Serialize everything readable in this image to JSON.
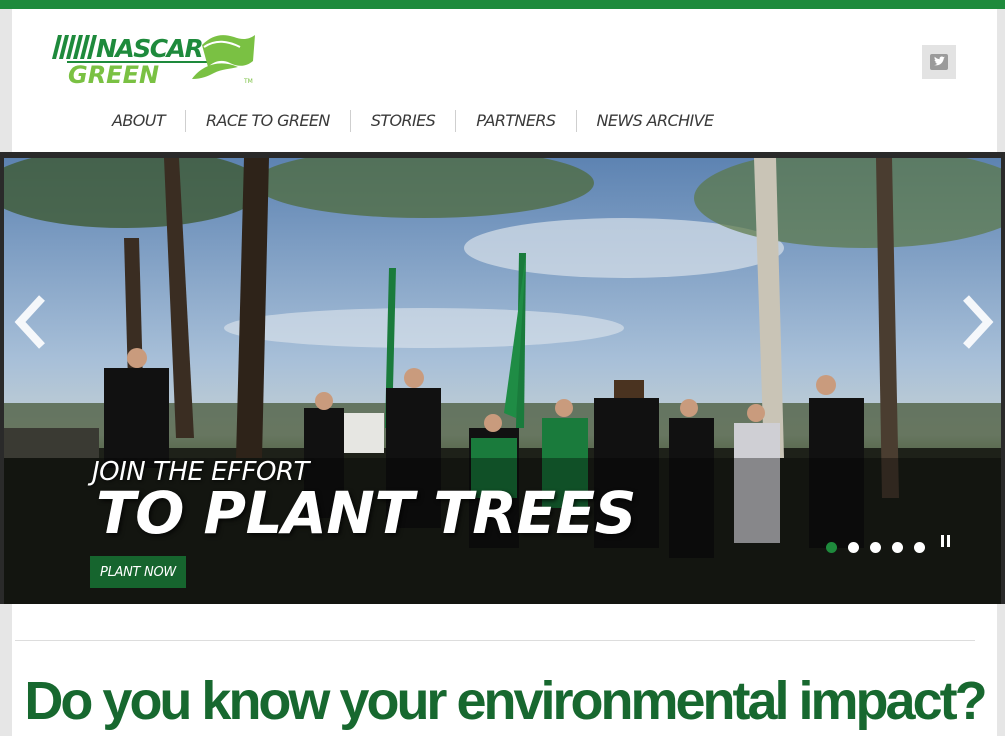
{
  "brand": {
    "logo_line1": "NASCAR",
    "logo_line2": "GREEN",
    "primary_color": "#1e8a3c",
    "dark_green": "#17682f",
    "light_green": "#7ac143"
  },
  "header": {
    "twitter_icon": "twitter-icon"
  },
  "nav": {
    "items": [
      {
        "label": "ABOUT"
      },
      {
        "label": "RACE TO GREEN"
      },
      {
        "label": "STORIES"
      },
      {
        "label": "PARTNERS"
      },
      {
        "label": "NEWS ARCHIVE"
      }
    ]
  },
  "hero": {
    "caption_small": "JOIN THE EFFORT",
    "caption_big": "TO PLANT TREES",
    "button_label": "PLANT NOW",
    "slide_count": 5,
    "active_slide": 1,
    "prev_icon": "chevron-left-icon",
    "next_icon": "chevron-right-icon",
    "pause_icon": "pause-icon"
  },
  "content": {
    "headline": "Do you know your environmental impact?"
  }
}
